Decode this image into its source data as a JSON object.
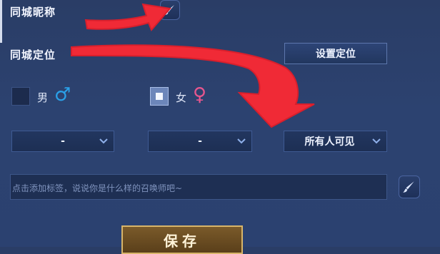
{
  "nickname": {
    "label": "同城昵称"
  },
  "location": {
    "label": "同城定位",
    "set_button": "设置定位"
  },
  "gender": {
    "male": {
      "label": "男",
      "symbol": "♂",
      "color": "#2aa0e8",
      "checked": false
    },
    "female": {
      "label": "女",
      "symbol": "♀",
      "color": "#e8568e",
      "checked": true
    }
  },
  "selects": {
    "first": {
      "value": "-"
    },
    "second": {
      "value": "-"
    },
    "visibility": {
      "value": "所有人可见"
    }
  },
  "tags": {
    "placeholder": "点击添加标签，说说你是什么样的召唤师吧~"
  },
  "save_button": {
    "label": "保存"
  },
  "colors": {
    "accent_gold": "#c9a45a",
    "arrow_red": "#f02a36"
  }
}
